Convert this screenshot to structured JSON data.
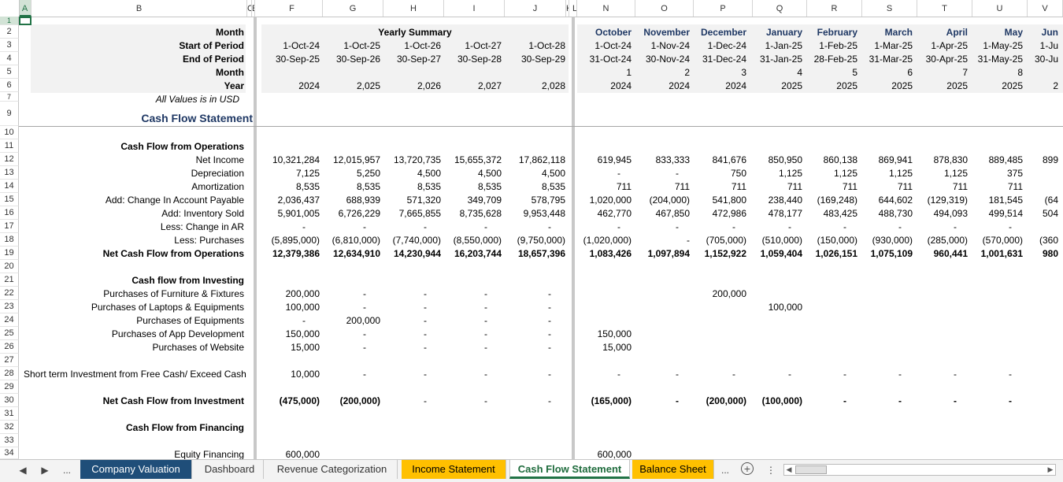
{
  "columns": [
    "A",
    "B",
    "C",
    "E",
    "F",
    "G",
    "H",
    "I",
    "J",
    "K",
    "L",
    "N",
    "O",
    "P",
    "Q",
    "R",
    "S",
    "T",
    "U",
    "V"
  ],
  "rows": [
    "1",
    "2",
    "3",
    "4",
    "5",
    "6",
    "7",
    "9",
    "10",
    "11",
    "12",
    "13",
    "14",
    "15",
    "16",
    "17",
    "18",
    "19",
    "20",
    "21",
    "22",
    "23",
    "24",
    "25",
    "26",
    "27",
    "28",
    "29",
    "30",
    "31",
    "32",
    "33",
    "34"
  ],
  "labels": {
    "month": "Month",
    "start": "Start of Period",
    "end": "End of Period",
    "month2": "Month",
    "year": "Year",
    "all_values": "All Values is in USD",
    "title": "Cash Flow Statement",
    "cfo": "Cash Flow from Operations",
    "net_income": "Net Income",
    "depreciation": "Depreciation",
    "amortization": "Amortization",
    "ap": "Add: Change In Account Payable",
    "inv": "Add: Inventory Sold",
    "ar": "Less: Change in AR",
    "purch": "Less: Purchases",
    "ncfo": "Net Cash Flow from Operations",
    "cfi": "Cash flow from Investing",
    "furn": "Purchases of Furniture & Fixtures",
    "laptops": "Purchases of Laptops & Equipments",
    "equip": "Purchases of Equipments",
    "app": "Purchases of App Development",
    "web": "Purchases of Website",
    "sti": "Short term Investment from Free Cash/ Exceed Cash",
    "ncfi": "Net Cash Flow from Investment",
    "cff": "Cash Flow from Financing",
    "equity": "Equity Financing"
  },
  "yearly": {
    "header": "Yearly Summary",
    "start": [
      "1-Oct-24",
      "1-Oct-25",
      "1-Oct-26",
      "1-Oct-27",
      "1-Oct-28"
    ],
    "end": [
      "30-Sep-25",
      "30-Sep-26",
      "30-Sep-27",
      "30-Sep-28",
      "30-Sep-29"
    ],
    "year": [
      "2024",
      "2,025",
      "2,026",
      "2,027",
      "2,028"
    ],
    "net_income": [
      "10,321,284",
      "12,015,957",
      "13,720,735",
      "15,655,372",
      "17,862,118"
    ],
    "depreciation": [
      "7,125",
      "5,250",
      "4,500",
      "4,500",
      "4,500"
    ],
    "amortization": [
      "8,535",
      "8,535",
      "8,535",
      "8,535",
      "8,535"
    ],
    "ap": [
      "2,036,437",
      "688,939",
      "571,320",
      "349,709",
      "578,795"
    ],
    "inv": [
      "5,901,005",
      "6,726,229",
      "7,665,855",
      "8,735,628",
      "9,953,448"
    ],
    "ar": [
      "-",
      "-",
      "-",
      "-",
      "-"
    ],
    "purch": [
      "(5,895,000)",
      "(6,810,000)",
      "(7,740,000)",
      "(8,550,000)",
      "(9,750,000)"
    ],
    "ncfo": [
      "12,379,386",
      "12,634,910",
      "14,230,944",
      "16,203,744",
      "18,657,396"
    ],
    "furn": [
      "200,000",
      "-",
      "-",
      "-",
      "-"
    ],
    "laptops": [
      "100,000",
      "-",
      "-",
      "-",
      "-"
    ],
    "equip": [
      "-",
      "200,000",
      "-",
      "-",
      "-"
    ],
    "app": [
      "150,000",
      "-",
      "-",
      "-",
      "-"
    ],
    "web": [
      "15,000",
      "-",
      "-",
      "-",
      "-"
    ],
    "sti": [
      "10,000",
      "-",
      "-",
      "-",
      "-"
    ],
    "ncfi": [
      "(475,000)",
      "(200,000)",
      "-",
      "-",
      "-"
    ],
    "equity": [
      "600,000",
      "",
      "",
      "",
      ""
    ]
  },
  "monthly": {
    "names": [
      "October",
      "November",
      "December",
      "January",
      "February",
      "March",
      "April",
      "May",
      "Jun"
    ],
    "start": [
      "1-Oct-24",
      "1-Nov-24",
      "1-Dec-24",
      "1-Jan-25",
      "1-Feb-25",
      "1-Mar-25",
      "1-Apr-25",
      "1-May-25",
      "1-Ju"
    ],
    "end": [
      "31-Oct-24",
      "30-Nov-24",
      "31-Dec-24",
      "31-Jan-25",
      "28-Feb-25",
      "31-Mar-25",
      "30-Apr-25",
      "31-May-25",
      "30-Ju"
    ],
    "month": [
      "1",
      "2",
      "3",
      "4",
      "5",
      "6",
      "7",
      "8",
      ""
    ],
    "year": [
      "2024",
      "2024",
      "2024",
      "2025",
      "2025",
      "2025",
      "2025",
      "2025",
      "2"
    ],
    "net_income": [
      "619,945",
      "833,333",
      "841,676",
      "850,950",
      "860,138",
      "869,941",
      "878,830",
      "889,485",
      "899"
    ],
    "depreciation": [
      "-",
      "-",
      "750",
      "1,125",
      "1,125",
      "1,125",
      "1,125",
      "375",
      ""
    ],
    "amortization": [
      "711",
      "711",
      "711",
      "711",
      "711",
      "711",
      "711",
      "711",
      ""
    ],
    "ap": [
      "1,020,000",
      "(204,000)",
      "541,800",
      "238,440",
      "(169,248)",
      "644,602",
      "(129,319)",
      "181,545",
      "(64"
    ],
    "inv": [
      "462,770",
      "467,850",
      "472,986",
      "478,177",
      "483,425",
      "488,730",
      "494,093",
      "499,514",
      "504"
    ],
    "ar": [
      "-",
      "-",
      "-",
      "-",
      "-",
      "-",
      "-",
      "-",
      ""
    ],
    "purch": [
      "(1,020,000)",
      "-",
      "(705,000)",
      "(510,000)",
      "(150,000)",
      "(930,000)",
      "(285,000)",
      "(570,000)",
      "(360"
    ],
    "ncfo": [
      "1,083,426",
      "1,097,894",
      "1,152,922",
      "1,059,404",
      "1,026,151",
      "1,075,109",
      "960,441",
      "1,001,631",
      "980"
    ],
    "furn": [
      "",
      "",
      "200,000",
      "",
      "",
      "",
      "",
      "",
      ""
    ],
    "laptops": [
      "",
      "",
      "",
      "100,000",
      "",
      "",
      "",
      "",
      ""
    ],
    "equip": [
      "",
      "",
      "",
      "",
      "",
      "",
      "",
      "",
      ""
    ],
    "app": [
      "150,000",
      "",
      "",
      "",
      "",
      "",
      "",
      "",
      ""
    ],
    "web": [
      "15,000",
      "",
      "",
      "",
      "",
      "",
      "",
      "",
      ""
    ],
    "sti": [
      "-",
      "-",
      "-",
      "-",
      "-",
      "-",
      "-",
      "-",
      ""
    ],
    "ncfi": [
      "(165,000)",
      "-",
      "(200,000)",
      "(100,000)",
      "-",
      "-",
      "-",
      "-",
      ""
    ],
    "equity": [
      "600,000",
      "",
      "",
      "",
      "",
      "",
      "",
      "",
      ""
    ]
  },
  "tabs": {
    "more_left": "...",
    "company_valuation": "Company Valuation",
    "dashboard": "Dashboard",
    "revenue_categorization": "Revenue Categorization",
    "income_statement": "Income Statement",
    "cash_flow_statement": "Cash Flow Statement",
    "balance_sheet": "Balance Sheet",
    "more_right": "..."
  },
  "colors": {
    "navy_tab": "#1f4e79",
    "orange_tab": "#ffc000",
    "header_text": "#1f3864",
    "excel_green": "#217346"
  }
}
